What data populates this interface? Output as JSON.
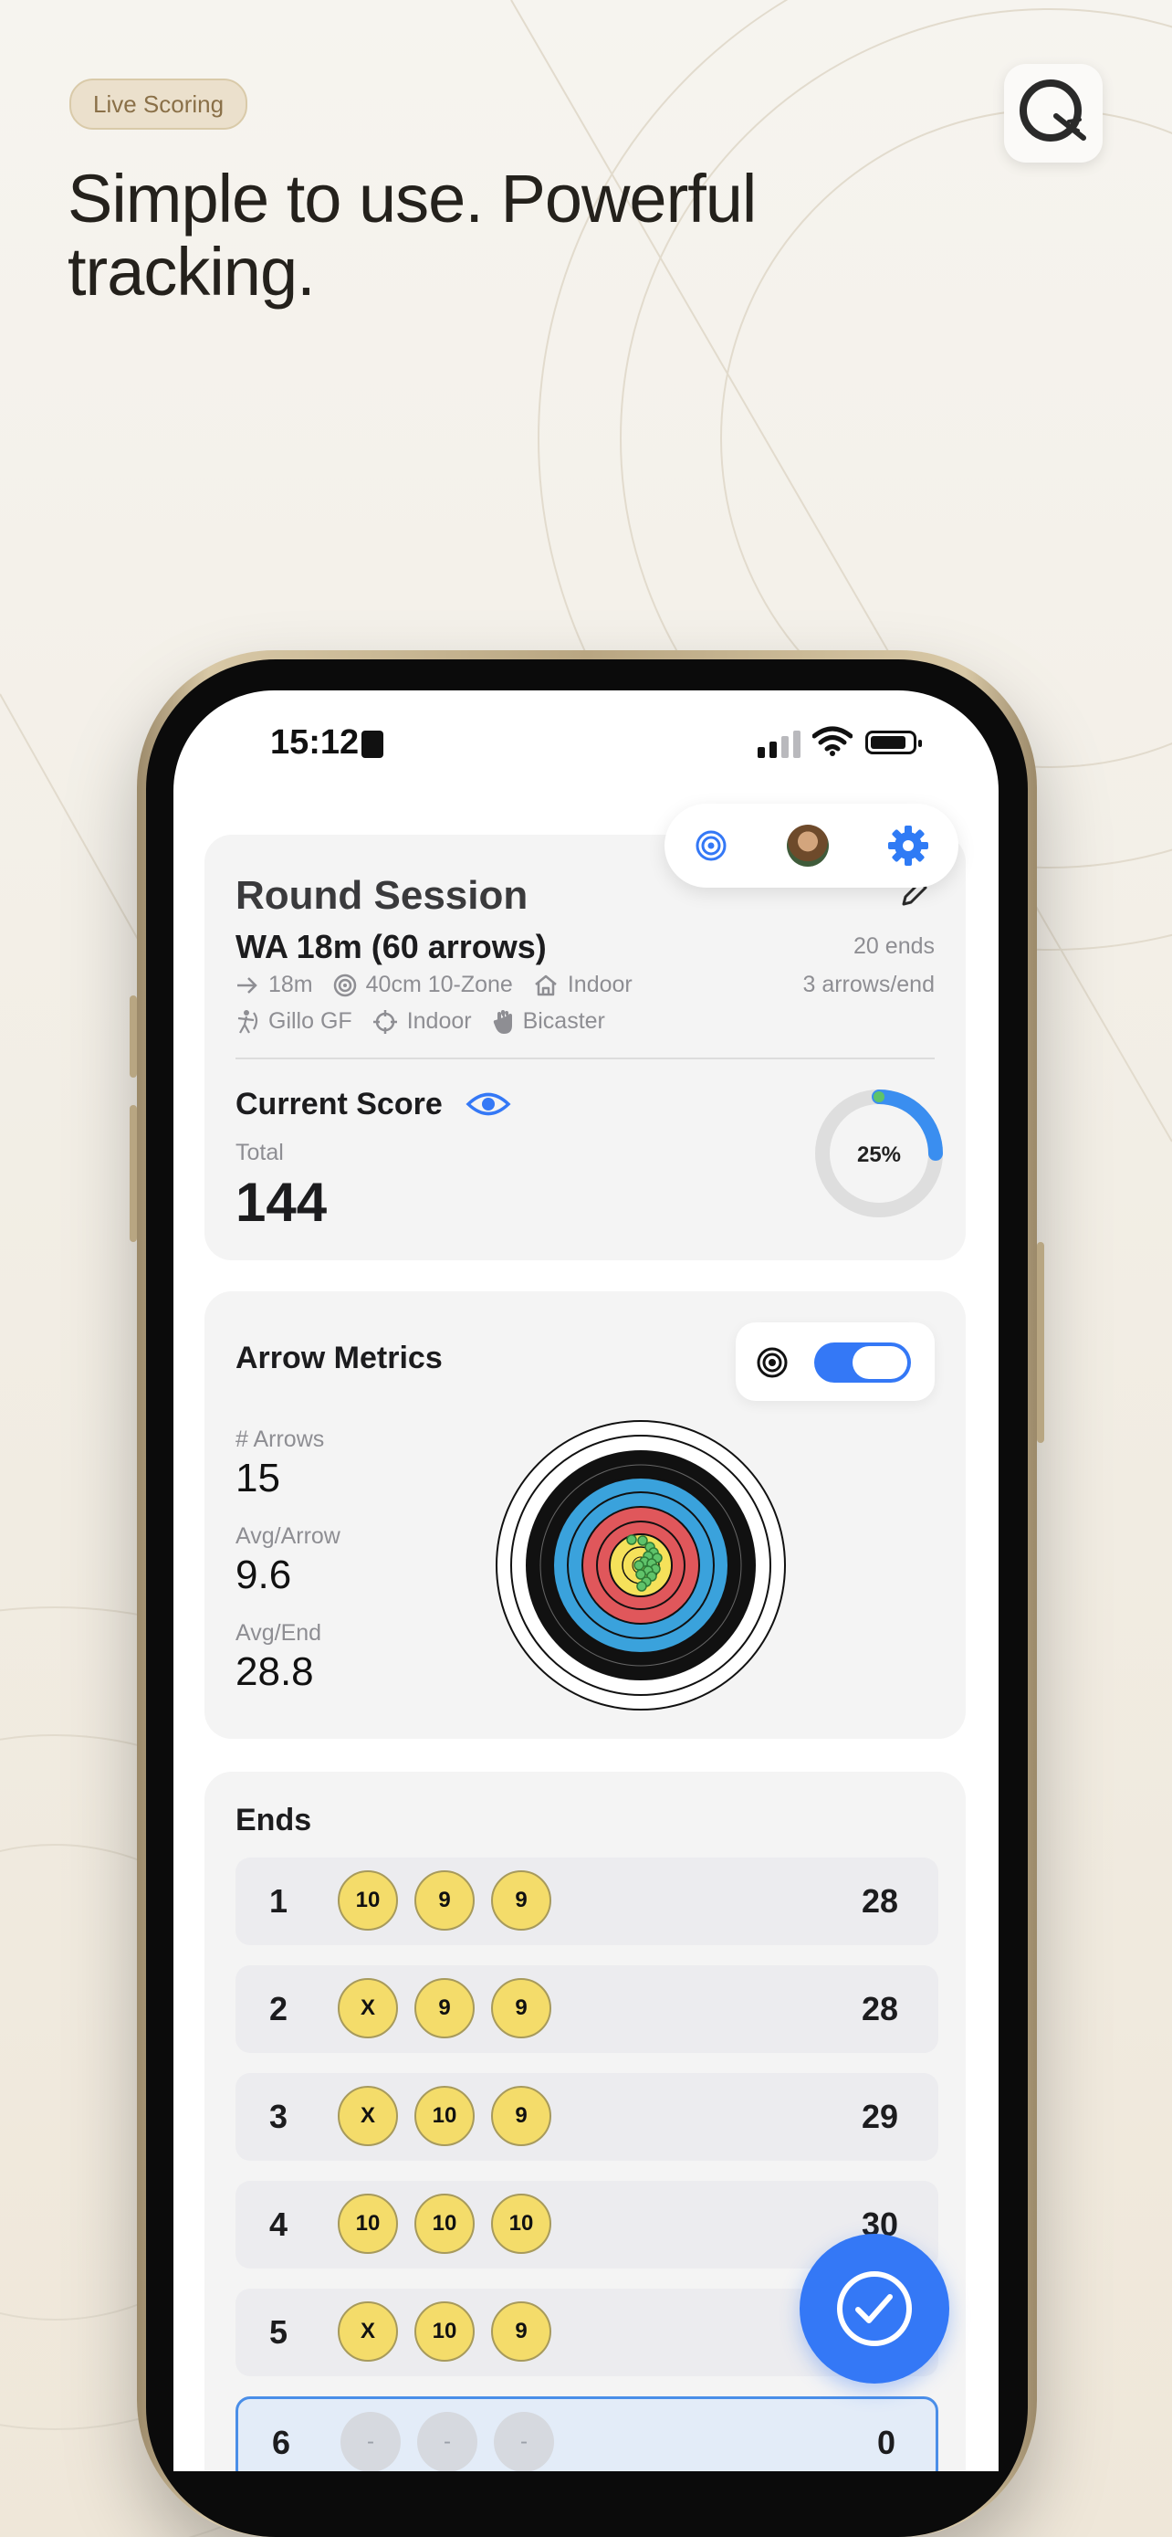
{
  "marketing": {
    "badge": "Live Scoring",
    "headline": "Simple to use. Powerful tracking."
  },
  "status_bar": {
    "time": "15:12"
  },
  "session": {
    "title": "Round Session",
    "round": "WA 18m (60 arrows)",
    "distance": "18m",
    "target_face": "40cm 10-Zone",
    "venue": "Indoor",
    "archer": "Gillo GF",
    "sight": "Indoor",
    "hand": "Bicaster",
    "ends_count": "20 ends",
    "arrows_per_end": "3 arrows/end"
  },
  "score": {
    "label": "Current Score",
    "total_label": "Total",
    "total": "144",
    "progress_label": "25%",
    "progress": 0.25
  },
  "metrics": {
    "title": "Arrow Metrics",
    "arrows_label": "# Arrows",
    "arrows": "15",
    "avg_arrow_label": "Avg/Arrow",
    "avg_arrow": "9.6",
    "avg_end_label": "Avg/End",
    "avg_end": "28.8",
    "target_view_enabled": true
  },
  "ends": {
    "title": "Ends",
    "rows": [
      {
        "num": "1",
        "arrows": [
          "10",
          "9",
          "9"
        ],
        "total": "28"
      },
      {
        "num": "2",
        "arrows": [
          "X",
          "9",
          "9"
        ],
        "total": "28"
      },
      {
        "num": "3",
        "arrows": [
          "X",
          "10",
          "9"
        ],
        "total": "29"
      },
      {
        "num": "4",
        "arrows": [
          "10",
          "10",
          "10"
        ],
        "total": "30"
      },
      {
        "num": "5",
        "arrows": [
          "X",
          "10",
          "9"
        ],
        "total": ""
      },
      {
        "num": "6",
        "arrows": [
          "-",
          "-",
          "-"
        ],
        "total": "0"
      }
    ]
  },
  "colors": {
    "accent": "#3478f6",
    "chip_gold": "#f4dc6a",
    "ring_red": "#e0575b",
    "ring_blue": "#3aa2dc"
  },
  "icons": [
    "target-icon",
    "avatar",
    "gear-icon",
    "edit-icon",
    "eye-icon",
    "check-icon"
  ]
}
